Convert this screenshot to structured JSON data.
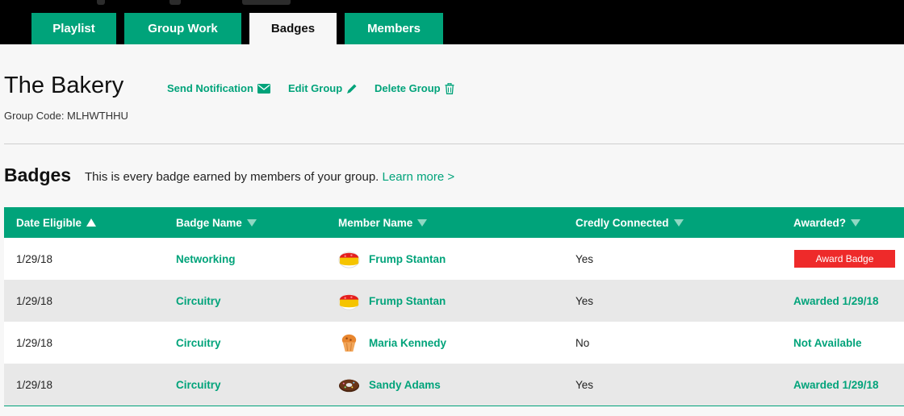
{
  "tabs": [
    {
      "label": "Playlist"
    },
    {
      "label": "Group Work"
    },
    {
      "label": "Badges"
    },
    {
      "label": "Members"
    }
  ],
  "active_tab": "Badges",
  "group": {
    "name": "The Bakery",
    "code_label": "Group Code: MLHWTHHU"
  },
  "actions": {
    "send_notification": "Send Notification",
    "edit_group": "Edit Group",
    "delete_group": "Delete Group"
  },
  "badges_section": {
    "heading": "Badges",
    "description": "This is every badge earned by members of your group.",
    "learn_more": "Learn more >"
  },
  "table": {
    "columns": [
      {
        "label": "Date Eligible",
        "sort": "ascending"
      },
      {
        "label": "Badge Name",
        "sort": "none"
      },
      {
        "label": "Member Name",
        "sort": "none"
      },
      {
        "label": "Credly Connected",
        "sort": "none"
      },
      {
        "label": "Awarded?",
        "sort": "none"
      }
    ],
    "rows": [
      {
        "date": "1/29/18",
        "badge": "Networking",
        "member": "Frump Stantan",
        "avatar": "cake-avatar-icon",
        "credly": "Yes",
        "awarded": "Award Badge",
        "awarded_type": "button"
      },
      {
        "date": "1/29/18",
        "badge": "Circuitry",
        "member": "Frump Stantan",
        "avatar": "cake-avatar-icon",
        "credly": "Yes",
        "awarded": "Awarded 1/29/18",
        "awarded_type": "text"
      },
      {
        "date": "1/29/18",
        "badge": "Circuitry",
        "member": "Maria Kennedy",
        "avatar": "muffin-avatar-icon",
        "credly": "No",
        "awarded": "Not Available",
        "awarded_type": "text"
      },
      {
        "date": "1/29/18",
        "badge": "Circuitry",
        "member": "Sandy Adams",
        "avatar": "donut-avatar-icon",
        "credly": "Yes",
        "awarded": "Awarded 1/29/18",
        "awarded_type": "text"
      }
    ]
  },
  "colors": {
    "accent": "#00a37a",
    "award_button": "#ee2a2a",
    "topbar": "#000000"
  }
}
